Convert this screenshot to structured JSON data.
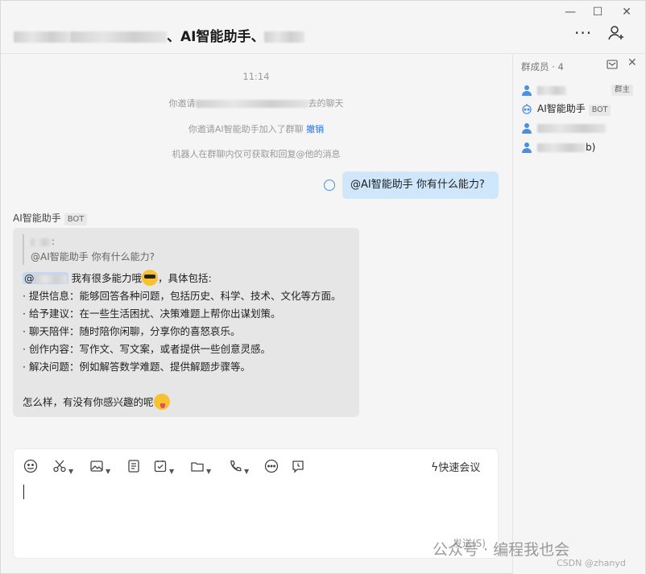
{
  "window": {
    "title_prefix": "、",
    "title_visible": "、AI智能助手、",
    "minimize": "—",
    "maximize": "☐",
    "close": "✕"
  },
  "header": {
    "more_label": "···"
  },
  "chat": {
    "time": "11:14",
    "sys_invite_prefix": "你邀请",
    "sys_invite_suffix": "去的聊天",
    "sys_bot_added": "你邀请AI智能助手加入了群聊",
    "sys_undo": "撤销",
    "sys_bot_notice": "机器人在群聊内仅可获取和回复@他的消息",
    "my_message": "@AI智能助手 你有什么能力?",
    "bot_name": "AI智能助手",
    "bot_tag": "BOT",
    "quote_name_suffix": ":",
    "quote_text": "@AI智能助手  你有什么能力?",
    "reply_mention": "@",
    "reply_intro": "我有很多能力哦",
    "reply_intro_tail": "，具体包括:",
    "reply_items": [
      "· 提供信息：能够回答各种问题，包括历史、科学、技术、文化等方面。",
      "· 给予建议：在一些生活困扰、决策难题上帮你出谋划策。",
      "· 聊天陪伴：随时陪你闲聊，分享你的喜怒哀乐。",
      "· 创作内容：写作文、写文案，或者提供一些创意灵感。",
      "· 解决问题：例如解答数学难题、提供解题步骤等。"
    ],
    "reply_outro": "怎么样，有没有你感兴趣的呢"
  },
  "composer": {
    "quick_meeting": "快速会议",
    "send_label": "发送(S)"
  },
  "members": {
    "header": "群成员 · 4",
    "list": [
      {
        "name": "",
        "tag": "群主",
        "icon": "user-icon"
      },
      {
        "name": "AI智能助手",
        "tag": "BOT",
        "icon": "robot-icon"
      },
      {
        "name": "",
        "tag": "",
        "icon": "user-icon"
      },
      {
        "name": "b)",
        "tag": "",
        "icon": "user-icon"
      }
    ]
  },
  "watermark": {
    "text": "公众号 · 编程我也会",
    "csdn": "CSDN @zhanyd"
  },
  "colors": {
    "accent": "#2b6fd6",
    "my_bubble": "#cfe6fb",
    "bot_bubble": "#e6e6e6"
  }
}
